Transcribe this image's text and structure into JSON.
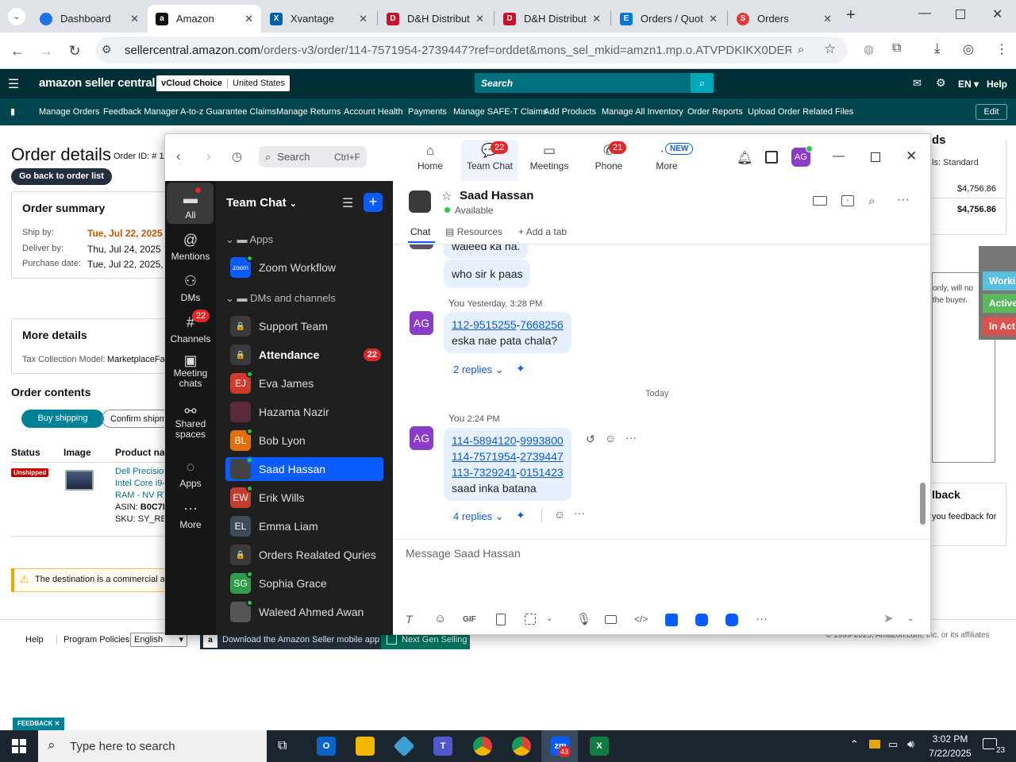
{
  "browser": {
    "tabs": [
      {
        "label": "Dashboard",
        "color": "#1a73e8"
      },
      {
        "label": "Amazon",
        "color": "#111111",
        "active": true
      },
      {
        "label": "Xvantage",
        "color": "#0060a9"
      },
      {
        "label": "D&H Distribut",
        "color": "#c8102e"
      },
      {
        "label": "D&H Distribut",
        "color": "#c8102e"
      },
      {
        "label": "Orders / Quot",
        "color": "#0078d4"
      },
      {
        "label": "Orders",
        "color": "#e53935"
      }
    ],
    "url_host": "sellercentral.amazon.com",
    "url_path": "/orders-v3/order/114-7571954-2739447?ref=orddet&mons_sel_mkid=amzn1.mp.o.ATVPDKIKX0DER&mons_..."
  },
  "amazon": {
    "logo": "amazon seller central",
    "store": "vCloud Choice",
    "region": "United States",
    "search_placeholder": "Search",
    "lang": "EN",
    "help": "Help",
    "nav": [
      "Manage Orders",
      "Feedback Manager",
      "A-to-z Guarantee Claims",
      "Manage Returns",
      "Account Health",
      "Payments",
      "Manage SAFE-T Claims",
      "Add Products",
      "Manage All Inventory",
      "Order Reports",
      "Upload Order Related Files"
    ],
    "edit": "Edit",
    "page_title": "Order details",
    "order_id_label": "Order ID: # 11",
    "back_btn": "Go back to order list",
    "summary_title": "Order summary",
    "ship_by_label": "Ship by:",
    "ship_by_value": "Tue, Jul 22, 2025 PD",
    "deliver_by_label": "Deliver by:",
    "deliver_by_value": "Thu, Jul 24, 2025 PD",
    "purchase_label": "Purchase date:",
    "purchase_value": "Tue, Jul 22, 2025, 9:0",
    "more_details": "More details",
    "tax_model_label": "Tax Collection Model:",
    "tax_model_value": "MarketplaceFac",
    "order_contents": "Order contents",
    "buy_shipping": "Buy shipping",
    "confirm_shipment": "Confirm shipme",
    "col_status": "Status",
    "col_image": "Image",
    "col_product": "Product nam",
    "status_value": "Unshipped",
    "product_lines": [
      "Dell Precision",
      "Intel Core i9-",
      "RAM - NV RT"
    ],
    "asin_label": "ASIN:",
    "asin_value": "B0C7L8",
    "sku_line": "SKU: SY_RB_",
    "warning": "The destination is a commercial ac",
    "right_ds": "ds",
    "right_standard": "ls: Standard",
    "amount1": "$4,756.86",
    "amount2": "$4,756.86",
    "right_note1": "only, will no",
    "right_note2": "the buyer.",
    "feedback_title": "lback",
    "feedback_text": "you feedback for",
    "side_tabs": [
      "Worki",
      "Active",
      "In Act"
    ],
    "footer_help": "Help",
    "footer_policies": "Program Policies",
    "footer_lang": "English",
    "footer_app": "Download the Amazon Seller mobile app",
    "footer_ngs": "Next Gen Selling",
    "footer_copy": "© 1999-2025, Amazon.com, Inc. or its affiliates",
    "feedback_tab": "FEEDBACK"
  },
  "zoom": {
    "search_label": "Search",
    "search_shortcut": "Ctrl+F",
    "top_tabs": [
      {
        "label": "Home",
        "badge": ""
      },
      {
        "label": "Team Chat",
        "badge": "22"
      },
      {
        "label": "Meetings",
        "badge": ""
      },
      {
        "label": "Phone",
        "badge": "21"
      },
      {
        "label": "More",
        "badge": "NEW"
      }
    ],
    "user_initials": "AG",
    "rail": [
      {
        "label": "All"
      },
      {
        "label": "Mentions"
      },
      {
        "label": "DMs"
      },
      {
        "label": "Channels",
        "badge": "22"
      },
      {
        "label": "Meeting chats"
      },
      {
        "label": "Shared spaces"
      },
      {
        "label": "Apps"
      },
      {
        "label": "More"
      }
    ],
    "list_title": "Team Chat",
    "section_apps": "Apps",
    "section_dms": "DMs and channels",
    "list_items": [
      {
        "label": "Zoom Workflow",
        "initials": "zoom",
        "color": "#0b5cff"
      },
      {
        "label": "Support Team",
        "initials": "🔒",
        "color": "#3a3a3a"
      },
      {
        "label": "Attendance",
        "initials": "🔒",
        "color": "#3a3a3a",
        "badge": "22"
      },
      {
        "label": "Eva James",
        "initials": "EJ",
        "color": "#d03b2e"
      },
      {
        "label": "Hazama Nazir",
        "initials": "",
        "color": "#5a2b3a"
      },
      {
        "label": "Bob Lyon",
        "initials": "BL",
        "color": "#e0700d"
      },
      {
        "label": "Saad Hassan",
        "initials": "",
        "color": "#444444"
      },
      {
        "label": "Erik Wills",
        "initials": "EW",
        "color": "#c43c2e"
      },
      {
        "label": "Emma Liam",
        "initials": "EL",
        "color": "#3d4a5a"
      },
      {
        "label": "Orders Realated Quries",
        "initials": "🔒",
        "color": "#3a3a3a"
      },
      {
        "label": "Sophia Grace",
        "initials": "SG",
        "color": "#2e9e4a"
      },
      {
        "label": "Waleed Ahmed Awan",
        "initials": "",
        "color": "#555555"
      }
    ],
    "chat_name": "Saad Hassan",
    "chat_status": "Available",
    "chat_tabs": [
      "Chat",
      "Resources",
      "Add a tab"
    ],
    "msg_top_partial": "waleed ka na.",
    "msg_who": "who sir k paas",
    "msg1_meta": "You",
    "msg1_time": "Yesterday, 3:28 PM",
    "msg1_link_a": "112-9515255",
    "msg1_link_b": "7668256",
    "msg1_text": "eska nae pata chala?",
    "msg1_replies": "2 replies",
    "divider_today": "Today",
    "msg2_meta": "You",
    "msg2_time": "2:24 PM",
    "msg2_links": [
      {
        "a": "114-5894120",
        "b": "9993800"
      },
      {
        "a": "114-7571954",
        "b": "2739447"
      },
      {
        "a": "113-7329241",
        "b": "0151423"
      }
    ],
    "msg2_text": "saad inka batana",
    "msg2_replies": "4 replies",
    "composer_placeholder": "Message Saad Hassan",
    "gif": "GIF"
  },
  "taskbar": {
    "search": "Type here to search",
    "time": "3:02 PM",
    "date": "7/22/2025",
    "notif": "23",
    "zoom_badge": "43"
  }
}
